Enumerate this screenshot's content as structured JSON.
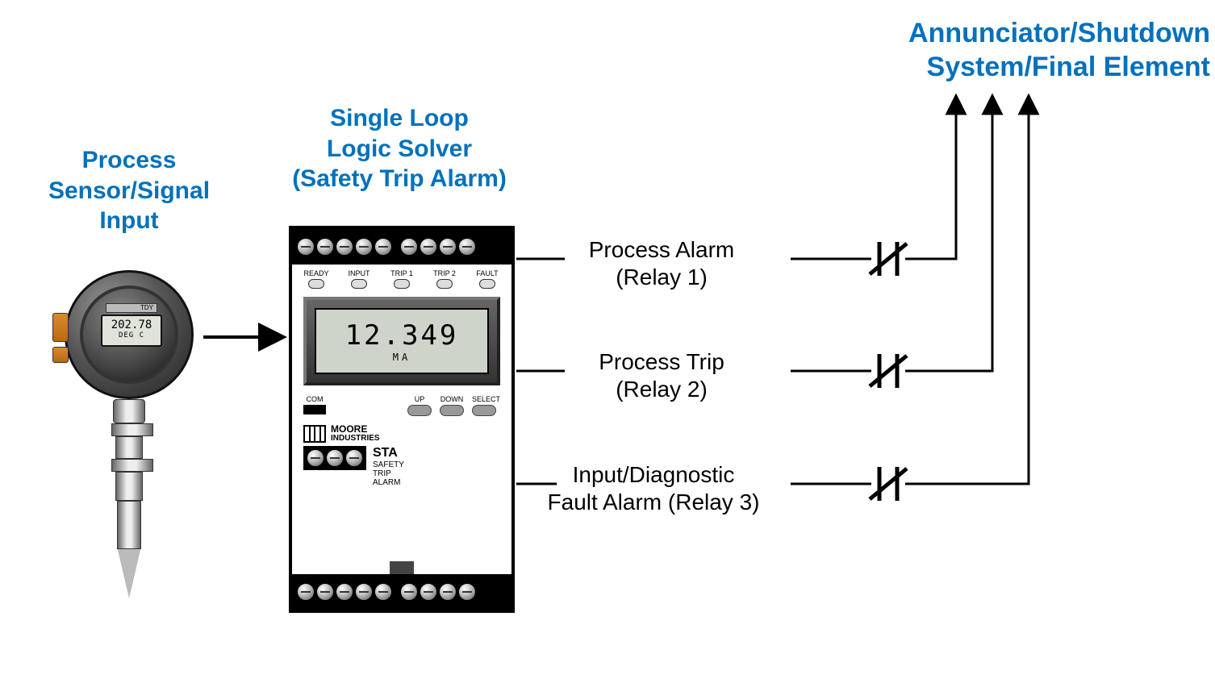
{
  "labels": {
    "sensor_title": "Process\nSensor/Signal\nInput",
    "solver_title": "Single Loop\nLogic Solver\n(Safety Trip Alarm)",
    "annunciator_line1": "Annunciator/Shutdown",
    "annunciator_line2": "System/Final Element",
    "relay1": "Process Alarm\n(Relay 1)",
    "relay2": "Process Trip\n(Relay 2)",
    "relay3": "Input/Diagnostic\nFault Alarm (Relay 3)"
  },
  "sensor": {
    "model": "TDY",
    "reading": "202.78",
    "unit": "DEG C"
  },
  "sta": {
    "leds": [
      "READY",
      "INPUT",
      "TRIP 1",
      "TRIP 2",
      "FAULT"
    ],
    "lcd_value": "12.349",
    "lcd_unit": "MA",
    "com_label": "COM",
    "buttons": [
      "UP",
      "DOWN",
      "SELECT"
    ],
    "brand_top": "MOORE",
    "brand_bottom": "INDUSTRIES",
    "model": "STA",
    "model_sub": "SAFETY\nTRIP\nALARM"
  }
}
